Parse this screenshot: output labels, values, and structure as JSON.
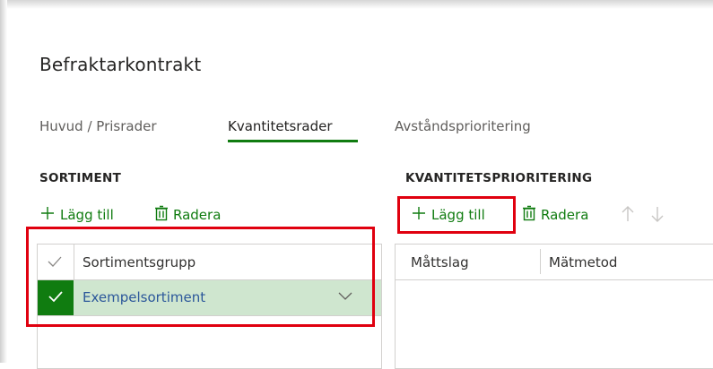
{
  "page": {
    "title": "Befraktarkontrakt"
  },
  "tabs": [
    {
      "label": "Huvud / Prisrader",
      "active": false
    },
    {
      "label": "Kvantitetsrader",
      "active": true
    },
    {
      "label": "Avståndsprioritering",
      "active": false
    }
  ],
  "sortiment": {
    "section_title": "SORTIMENT",
    "toolbar": {
      "add_label": "Lägg till",
      "delete_label": "Radera"
    },
    "grid": {
      "header": "Sortimentsgrupp",
      "rows": [
        {
          "value": "Exempelsortiment",
          "selected": true
        }
      ]
    }
  },
  "kvantitet": {
    "section_title": "KVANTITETSPRIORITERING",
    "toolbar": {
      "add_label": "Lägg till",
      "delete_label": "Radera"
    },
    "grid": {
      "columns": [
        "Måttslag",
        "Mätmetod"
      ]
    }
  },
  "colors": {
    "accent": "#107c10",
    "highlight": "#e0000f",
    "selected_row": "#cfe6cf",
    "link": "#2b579a"
  }
}
